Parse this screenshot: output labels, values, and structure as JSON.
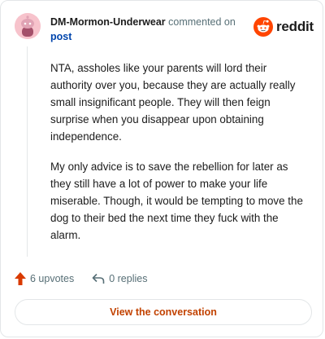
{
  "header": {
    "username": "DM-Mormon-Underwear",
    "action_text": "commented on",
    "post_link": "post"
  },
  "logo": {
    "wordmark": "reddit",
    "icon": "reddit-snoo-icon",
    "brand_color": "#ff4500"
  },
  "comment": {
    "paragraphs": [
      "NTA, assholes like your parents will lord their authority over you, because they are actually really small insignificant people. They will then feign surprise when you disappear upon obtaining independence.",
      "My only advice is to save the rebellion for later as they still have a lot of power to make your life miserable. Though, it would be tempting to move the dog to their bed the next time they fuck with the alarm."
    ]
  },
  "actions": {
    "upvotes": "6 upvotes",
    "replies": "0 replies",
    "upvote_icon": "upvote-arrow-icon",
    "reply_icon": "reply-arrow-icon",
    "upvote_color": "#d93a00"
  },
  "cta": {
    "label": "View the conversation",
    "color": "#c24200"
  }
}
